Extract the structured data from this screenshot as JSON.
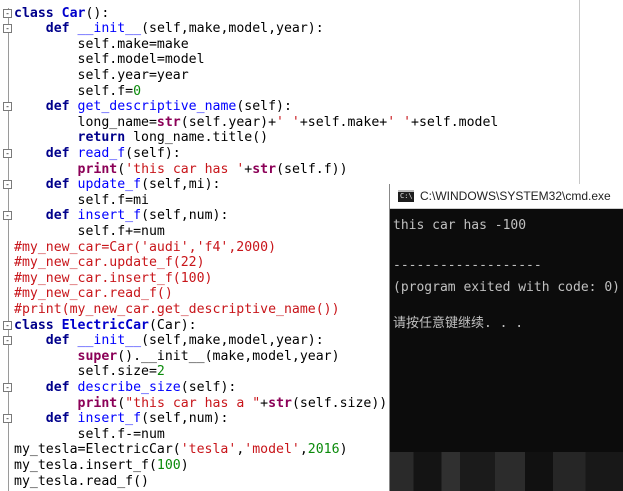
{
  "editor": {
    "lines": [
      {
        "fold": "-",
        "tokens": [
          {
            "c": "kw",
            "t": "class "
          },
          {
            "c": "cls",
            "t": "Car"
          },
          {
            "t": "():"
          }
        ]
      },
      {
        "fold": "-",
        "tokens": [
          {
            "t": "    "
          },
          {
            "c": "kw",
            "t": "def "
          },
          {
            "c": "fn",
            "t": "__init__"
          },
          {
            "t": "(self,make,model,year):"
          }
        ]
      },
      {
        "tokens": [
          {
            "t": "        self.make=make"
          }
        ]
      },
      {
        "tokens": [
          {
            "t": "        self.model=model"
          }
        ]
      },
      {
        "tokens": [
          {
            "t": "        self.year=year"
          }
        ]
      },
      {
        "tokens": [
          {
            "t": "        self.f="
          },
          {
            "c": "num",
            "t": "0"
          }
        ]
      },
      {
        "fold": "-",
        "tokens": [
          {
            "t": "    "
          },
          {
            "c": "kw",
            "t": "def "
          },
          {
            "c": "fn",
            "t": "get_descriptive_name"
          },
          {
            "t": "(self):"
          }
        ]
      },
      {
        "tokens": [
          {
            "t": "        long_name="
          },
          {
            "c": "bi",
            "t": "str"
          },
          {
            "t": "(self.year)+"
          },
          {
            "c": "str",
            "t": "' '"
          },
          {
            "t": "+self.make+"
          },
          {
            "c": "str",
            "t": "' '"
          },
          {
            "t": "+self.model"
          }
        ]
      },
      {
        "tokens": [
          {
            "t": "        "
          },
          {
            "c": "kw",
            "t": "return"
          },
          {
            "t": " long_name.title()"
          }
        ]
      },
      {
        "fold": "-",
        "tokens": [
          {
            "t": "    "
          },
          {
            "c": "kw",
            "t": "def "
          },
          {
            "c": "fn",
            "t": "read_f"
          },
          {
            "t": "(self):"
          }
        ]
      },
      {
        "tokens": [
          {
            "t": "        "
          },
          {
            "c": "bi",
            "t": "print"
          },
          {
            "t": "("
          },
          {
            "c": "str",
            "t": "'this car has '"
          },
          {
            "t": "+"
          },
          {
            "c": "bi",
            "t": "str"
          },
          {
            "t": "(self.f))"
          }
        ]
      },
      {
        "fold": "-",
        "tokens": [
          {
            "t": "    "
          },
          {
            "c": "kw",
            "t": "def "
          },
          {
            "c": "fn",
            "t": "update_f"
          },
          {
            "t": "(self,mi):"
          }
        ]
      },
      {
        "tokens": [
          {
            "t": "        self.f=mi"
          }
        ]
      },
      {
        "fold": "-",
        "tokens": [
          {
            "t": "    "
          },
          {
            "c": "kw",
            "t": "def "
          },
          {
            "c": "fn",
            "t": "insert_f"
          },
          {
            "t": "(self,num):"
          }
        ]
      },
      {
        "tokens": [
          {
            "t": "        self.f+=num"
          }
        ]
      },
      {
        "tokens": [
          {
            "c": "cm",
            "t": "#my_new_car=Car('audi','f4',2000)"
          }
        ]
      },
      {
        "tokens": [
          {
            "c": "cm",
            "t": "#my_new_car.update_f(22)"
          }
        ]
      },
      {
        "tokens": [
          {
            "c": "cm",
            "t": "#my_new_car.insert_f(100)"
          }
        ]
      },
      {
        "tokens": [
          {
            "c": "cm",
            "t": "#my_new_car.read_f()"
          }
        ]
      },
      {
        "tokens": [
          {
            "c": "cm",
            "t": "#print(my_new_car.get_descriptive_name())"
          }
        ]
      },
      {
        "fold": "-",
        "tokens": [
          {
            "c": "kw",
            "t": "class "
          },
          {
            "c": "cls",
            "t": "ElectricCar"
          },
          {
            "t": "(Car):"
          }
        ]
      },
      {
        "fold": "-",
        "tokens": [
          {
            "t": "    "
          },
          {
            "c": "kw",
            "t": "def "
          },
          {
            "c": "fn",
            "t": "__init__"
          },
          {
            "t": "(self,make,model,year):"
          }
        ]
      },
      {
        "tokens": [
          {
            "t": "        "
          },
          {
            "c": "bi",
            "t": "super"
          },
          {
            "t": "().__init__(make,model,year)"
          }
        ]
      },
      {
        "tokens": [
          {
            "t": "        self.size="
          },
          {
            "c": "num",
            "t": "2"
          }
        ]
      },
      {
        "fold": "-",
        "tokens": [
          {
            "t": "    "
          },
          {
            "c": "kw",
            "t": "def "
          },
          {
            "c": "fn",
            "t": "describe_size"
          },
          {
            "t": "(self):"
          }
        ]
      },
      {
        "tokens": [
          {
            "t": "        "
          },
          {
            "c": "bi",
            "t": "print"
          },
          {
            "t": "("
          },
          {
            "c": "str",
            "t": "\"this car has a \""
          },
          {
            "t": "+"
          },
          {
            "c": "bi",
            "t": "str"
          },
          {
            "t": "(self.size))"
          }
        ]
      },
      {
        "fold": "-",
        "tokens": [
          {
            "t": "    "
          },
          {
            "c": "kw",
            "t": "def "
          },
          {
            "c": "fn",
            "t": "insert_f"
          },
          {
            "t": "(self,num):"
          }
        ]
      },
      {
        "tokens": [
          {
            "t": "        self.f-=num"
          }
        ]
      },
      {
        "tokens": [
          {
            "t": "my_tesla=ElectricCar("
          },
          {
            "c": "str",
            "t": "'tesla'"
          },
          {
            "t": ","
          },
          {
            "c": "str",
            "t": "'model'"
          },
          {
            "t": ","
          },
          {
            "c": "num",
            "t": "2016"
          },
          {
            "t": ")"
          }
        ]
      },
      {
        "tokens": [
          {
            "t": "my_tesla.insert_f("
          },
          {
            "c": "num",
            "t": "100"
          },
          {
            "t": ")"
          }
        ]
      },
      {
        "tokens": [
          {
            "t": "my_tesla.read_f()"
          }
        ]
      }
    ]
  },
  "console": {
    "title": "C:\\WINDOWS\\SYSTEM32\\cmd.exe",
    "icon_text": "C:\\",
    "lines": [
      "this car has -100",
      "",
      "-------------------",
      "(program exited with code: 0)",
      "",
      "请按任意键继续. . ."
    ]
  },
  "colors": {
    "keyword": "#00008b",
    "function": "#0000ff",
    "string": "#c8151a",
    "number": "#0a8a0a",
    "console_bg": "#0c0c0c",
    "console_text": "#c0c0c0"
  }
}
